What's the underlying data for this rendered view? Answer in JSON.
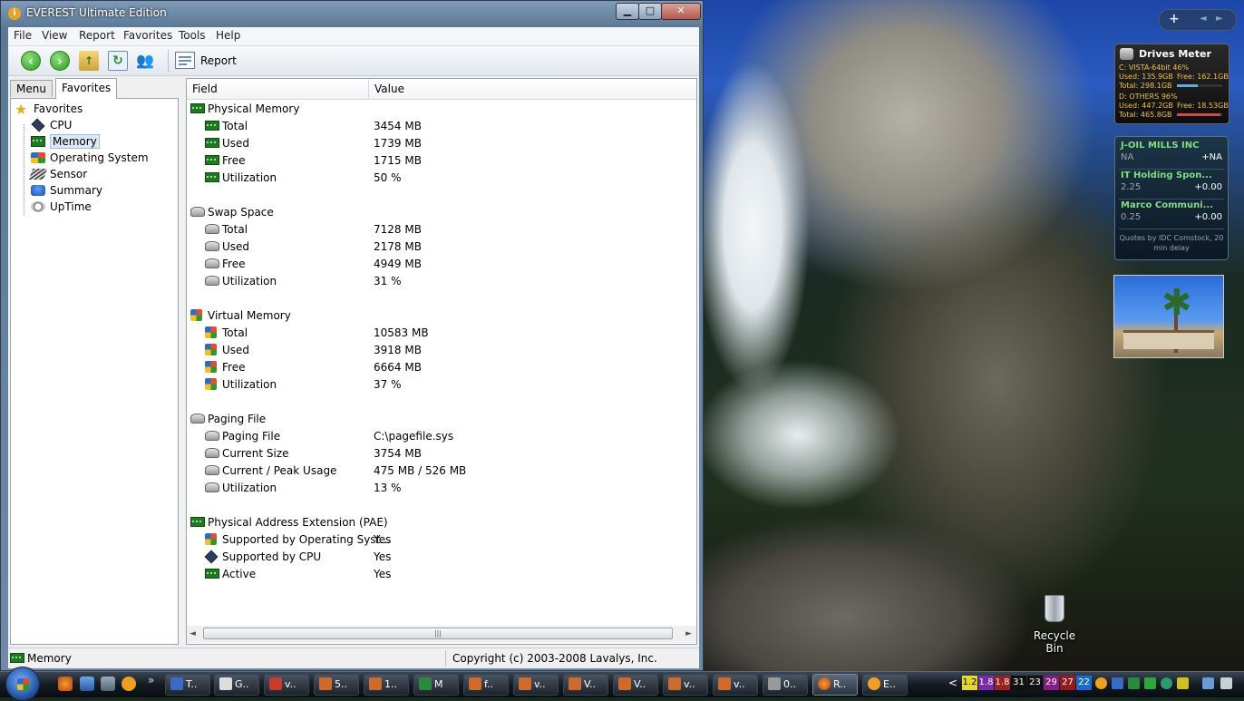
{
  "window": {
    "title": "EVEREST Ultimate Edition",
    "min_label": "▁",
    "max_label": "□",
    "close_label": "✕",
    "title_icon": "i"
  },
  "menubar": [
    "File",
    "View",
    "Report",
    "Favorites",
    "Tools",
    "Help"
  ],
  "toolbar": {
    "report_label": "Report"
  },
  "tabs": {
    "menu": "Menu",
    "favorites": "Favorites"
  },
  "tree": {
    "root": "Favorites",
    "items": [
      "CPU",
      "Memory",
      "Operating System",
      "Sensor",
      "Summary",
      "UpTime"
    ],
    "selected": "Memory"
  },
  "list": {
    "header_field": "Field",
    "header_value": "Value",
    "sections": [
      {
        "title": "Physical Memory",
        "icon": "memory-icon",
        "rows": [
          {
            "field": "Total",
            "value": "3454 MB"
          },
          {
            "field": "Used",
            "value": "1739 MB"
          },
          {
            "field": "Free",
            "value": "1715 MB"
          },
          {
            "field": "Utilization",
            "value": "50 %"
          }
        ]
      },
      {
        "title": "Swap Space",
        "icon": "disk-icon",
        "rows": [
          {
            "field": "Total",
            "value": "7128 MB"
          },
          {
            "field": "Used",
            "value": "2178 MB"
          },
          {
            "field": "Free",
            "value": "4949 MB"
          },
          {
            "field": "Utilization",
            "value": "31 %"
          }
        ]
      },
      {
        "title": "Virtual Memory",
        "icon": "windows-icon",
        "rows": [
          {
            "field": "Total",
            "value": "10583 MB"
          },
          {
            "field": "Used",
            "value": "3918 MB"
          },
          {
            "field": "Free",
            "value": "6664 MB"
          },
          {
            "field": "Utilization",
            "value": "37 %"
          }
        ]
      },
      {
        "title": "Paging File",
        "icon": "disk-icon",
        "rows": [
          {
            "field": "Paging File",
            "value": "C:\\pagefile.sys"
          },
          {
            "field": "Current Size",
            "value": "3754 MB"
          },
          {
            "field": "Current / Peak Usage",
            "value": "475 MB / 526 MB"
          },
          {
            "field": "Utilization",
            "value": "13 %"
          }
        ]
      },
      {
        "title": "Physical Address Extension (PAE)",
        "icon": "memory-icon",
        "rows": [
          {
            "field": "Supported by Operating Syst...",
            "value": "Yes"
          },
          {
            "field": "Supported by CPU",
            "value": "Yes"
          },
          {
            "field": "Active",
            "value": "Yes"
          }
        ]
      }
    ]
  },
  "statusbar": {
    "left": "Memory",
    "right": "Copyright (c) 2003-2008 Lavalys, Inc."
  },
  "sidebar": {
    "controls": {
      "add": "+",
      "prev": "◄",
      "next": "►"
    },
    "drives": {
      "title": "Drives Meter",
      "c_header": "C:  VISTA-64bit  46%",
      "c_used": "Used: 135.9GB",
      "c_free": "Free: 162.1GB",
      "c_total": "Total: 298.1GB",
      "c_fill": 0.46,
      "d_header": "D:  OTHERS  96%",
      "d_used": "Used: 447.2GB",
      "d_free": "Free: 18.53GB",
      "d_total": "Total: 465.8GB",
      "d_fill": 0.96
    },
    "stocks": {
      "items": [
        {
          "name": "J-OIL MILLS INC",
          "price": "NA",
          "change": "+NA"
        },
        {
          "name": "IT Holding Spon...",
          "price": "2.25",
          "change": "+0.00"
        },
        {
          "name": "Marco Communi...",
          "price": "0.25",
          "change": "+0.00"
        }
      ],
      "footer": "Quotes by IDC Comstock, 20 min delay"
    }
  },
  "desktop": {
    "recycle_bin": "Recycle Bin"
  },
  "taskbar": {
    "more": "»",
    "buttons": [
      "T..",
      "G..",
      "v..",
      "5..",
      "1..",
      "M",
      "f..",
      "v..",
      "V..",
      "V..",
      "v..",
      "v..",
      "0..",
      "R..",
      "E.."
    ],
    "tray_arrow": "<",
    "tray_numbers": [
      "1.2",
      "1.8",
      "1.8",
      "31",
      "23",
      "29",
      "27",
      "22"
    ]
  }
}
